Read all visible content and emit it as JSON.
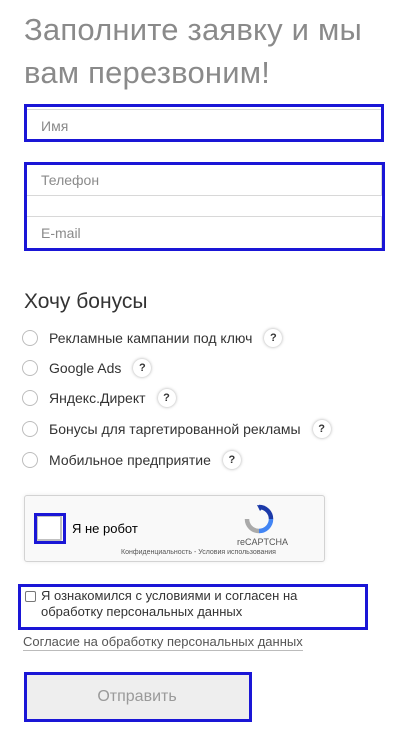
{
  "form": {
    "heading": "Заполните заявку и мы вам перезвоним!",
    "fields": {
      "name_placeholder": "Имя",
      "phone_placeholder": "Телефон",
      "email_placeholder": "E-mail"
    },
    "bonuses": {
      "title": "Хочу бонусы",
      "options": [
        {
          "label": "Рекламные кампании под ключ",
          "help": "?"
        },
        {
          "label": "Google Ads",
          "help": "?"
        },
        {
          "label": "Яндекс.Директ",
          "help": "?"
        },
        {
          "label": "Бонусы для таргетированной рекламы",
          "help": "?"
        },
        {
          "label": "Мобильное предприятие",
          "help": "?"
        }
      ]
    },
    "captcha": {
      "label": "Я не робот",
      "brand": "reCAPTCHA",
      "links": "Конфиденциальность - Условия использования"
    },
    "consent": {
      "text": "Я ознакомился с условиями и согласен на обработку персональных данных",
      "link": "Согласие на обработку персональных данных"
    },
    "submit_label": "Отправить"
  },
  "colors": {
    "highlight": "#1a16d6",
    "heading": "#8a8a8a",
    "button_bg": "#eeeeee",
    "button_text": "#9a9a9a"
  }
}
